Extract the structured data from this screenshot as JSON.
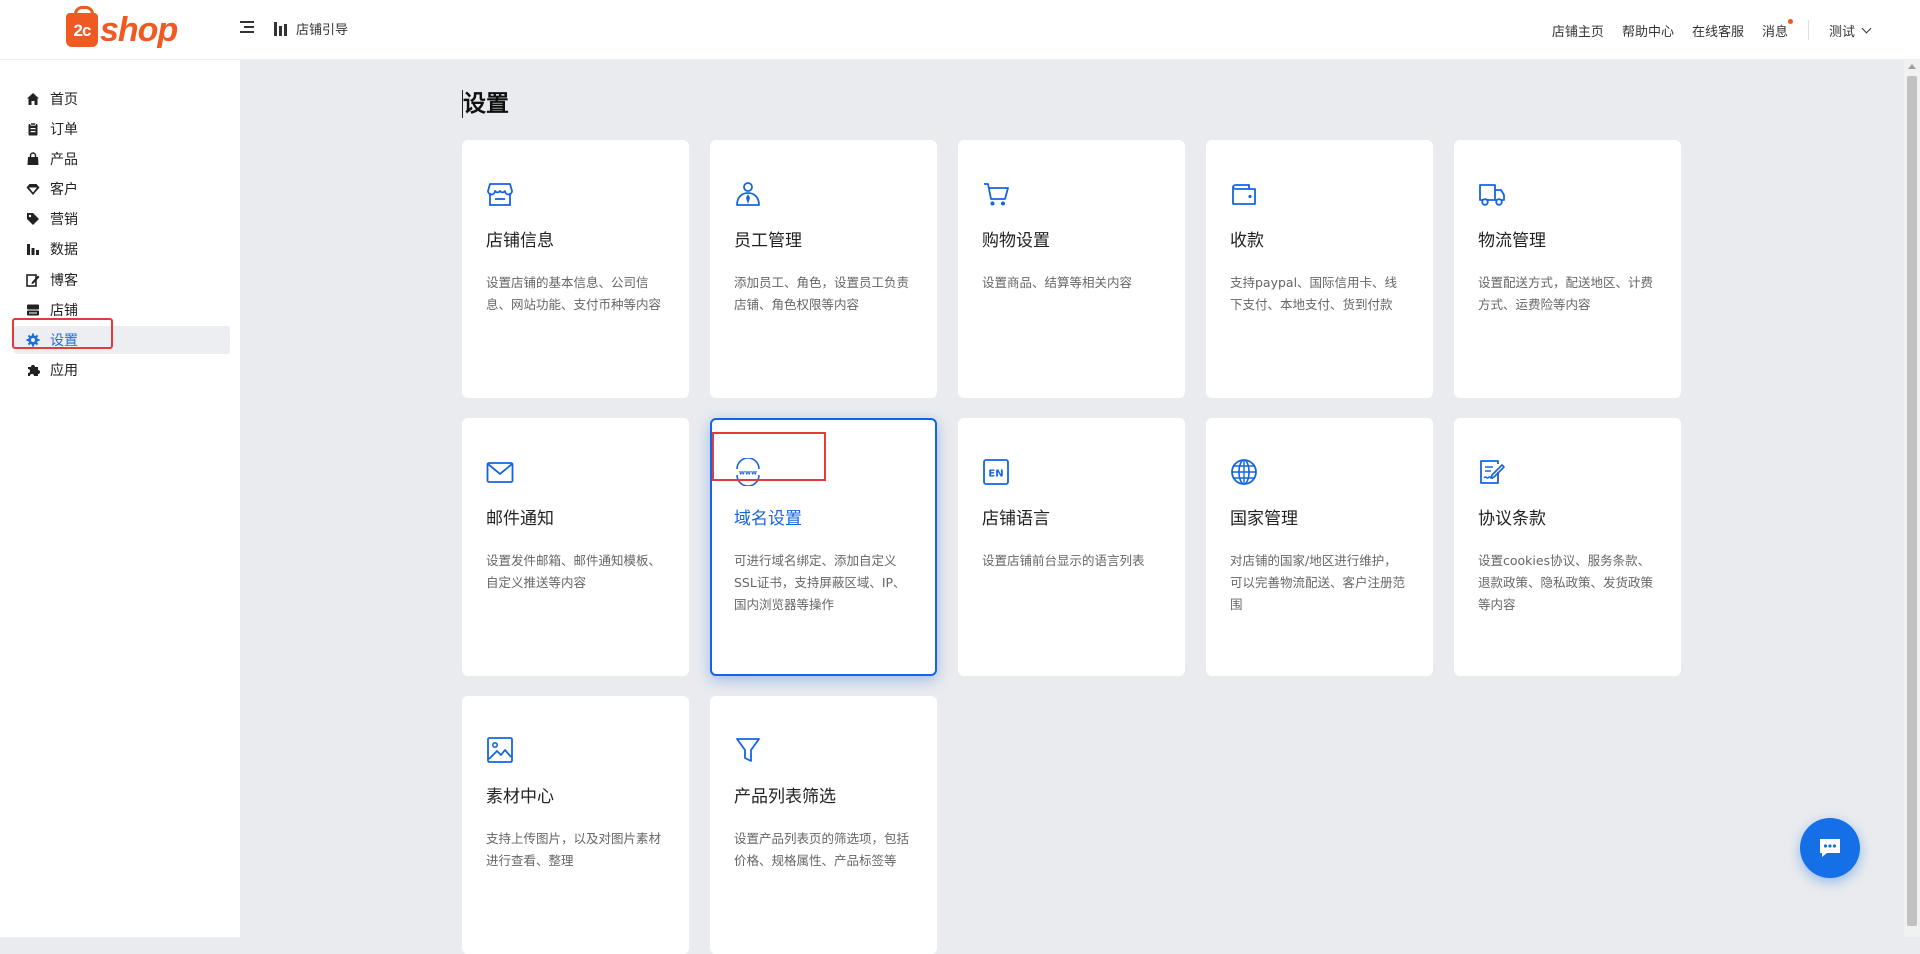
{
  "app": {
    "logo": {
      "mark": "2c",
      "text": "shop"
    },
    "guide_label": "店铺引导"
  },
  "header": {
    "links": [
      "店铺主页",
      "帮助中心",
      "在线客服",
      "消息"
    ],
    "user_name": "测试"
  },
  "sidebar": {
    "items": [
      {
        "label": "首页",
        "icon": "home-icon"
      },
      {
        "label": "订单",
        "icon": "clipboard-icon"
      },
      {
        "label": "产品",
        "icon": "bag-icon"
      },
      {
        "label": "客户",
        "icon": "diamond-icon"
      },
      {
        "label": "营销",
        "icon": "tag-icon"
      },
      {
        "label": "数据",
        "icon": "bar-chart-icon"
      },
      {
        "label": "博客",
        "icon": "edit-icon"
      },
      {
        "label": "店铺",
        "icon": "store-icon"
      },
      {
        "label": "设置",
        "icon": "gear-icon",
        "active": true
      },
      {
        "label": "应用",
        "icon": "puzzle-icon"
      }
    ]
  },
  "main": {
    "title": "设置",
    "cards": [
      {
        "title": "店铺信息",
        "desc": "设置店铺的基本信息、公司信息、网站功能、支付币种等内容",
        "icon": "storefront-icon"
      },
      {
        "title": "员工管理",
        "desc": "添加员工、角色，设置员工负责店铺、角色权限等内容",
        "icon": "staff-icon"
      },
      {
        "title": "购物设置",
        "desc": "设置商品、结算等相关内容",
        "icon": "cart-icon"
      },
      {
        "title": "收款",
        "desc": "支持paypal、国际信用卡、线下支付、本地支付、货到付款",
        "icon": "wallet-icon"
      },
      {
        "title": "物流管理",
        "desc": "设置配送方式，配送地区、计费方式、运费险等内容",
        "icon": "truck-icon"
      },
      {
        "title": "邮件通知",
        "desc": "设置发件邮箱、邮件通知模板、自定义推送等内容",
        "icon": "mail-icon"
      },
      {
        "title": "域名设置",
        "desc": "可进行域名绑定、添加自定义SSL证书，支持屏蔽区域、IP、国内浏览器等操作",
        "icon": "www-icon",
        "selected": true
      },
      {
        "title": "店铺语言",
        "desc": "设置店铺前台显示的语言列表",
        "icon": "language-en-icon"
      },
      {
        "title": "国家管理",
        "desc": "对店铺的国家/地区进行维护，可以完善物流配送、客户注册范围",
        "icon": "globe-icon"
      },
      {
        "title": "协议条款",
        "desc": "设置cookies协议、服务条款、退款政策、隐私政策、发货政策等内容",
        "icon": "document-sign-icon"
      },
      {
        "title": "素材中心",
        "desc": "支持上传图片，以及对图片素材进行查看、整理",
        "icon": "image-icon"
      },
      {
        "title": "产品列表筛选",
        "desc": "设置产品列表页的筛选项，包括价格、规格属性、产品标签等",
        "icon": "filter-icon"
      }
    ]
  },
  "colors": {
    "brand": "#f05a22",
    "accent": "#1565e0",
    "annotation": "#e23b3b"
  }
}
